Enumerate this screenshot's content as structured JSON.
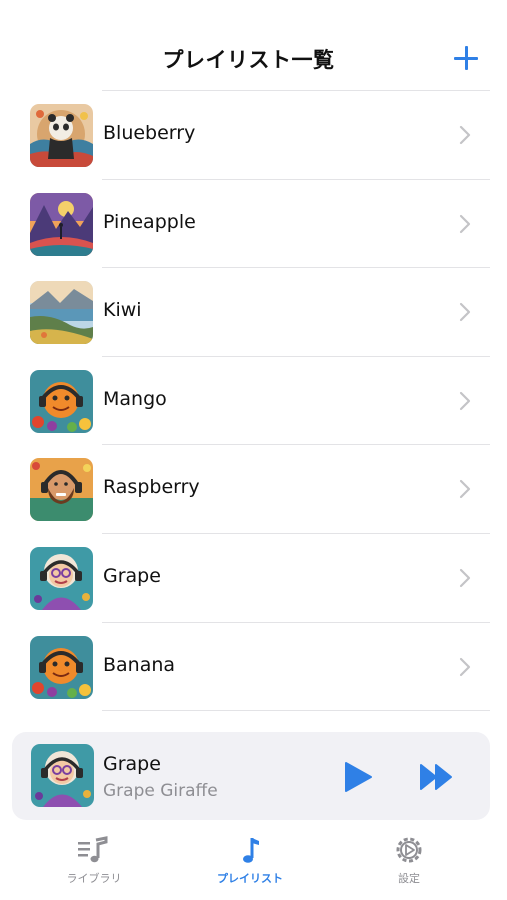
{
  "header": {
    "title": "プレイリスト一覧",
    "add_icon": "plus-icon"
  },
  "playlists": [
    {
      "name": "Blueberry",
      "art": "panda-art"
    },
    {
      "name": "Pineapple",
      "art": "mountain-art"
    },
    {
      "name": "Kiwi",
      "art": "coast-art"
    },
    {
      "name": "Mango",
      "art": "orange-dj-art"
    },
    {
      "name": "Raspberry",
      "art": "bearded-man-headphones-art"
    },
    {
      "name": "Grape",
      "art": "elderly-woman-headphones-art"
    },
    {
      "name": "Banana",
      "art": "orange-dj-art"
    }
  ],
  "now_playing": {
    "title": "Grape",
    "subtitle": "Grape Giraffe",
    "art": "elderly-woman-headphones-art",
    "controls": [
      "play-icon",
      "fast-forward-icon"
    ]
  },
  "tabs": [
    {
      "label": "ライブラリ",
      "icon": "library-icon",
      "active": false
    },
    {
      "label": "プレイリスト",
      "icon": "music-note-icon",
      "active": true
    },
    {
      "label": "設定",
      "icon": "gear-icon",
      "active": false
    }
  ],
  "colors": {
    "accent": "#2f80e6",
    "secondary_text": "#8e8e93",
    "separator": "#e3e3e6",
    "mini_player_bg": "#f1f1f5"
  }
}
